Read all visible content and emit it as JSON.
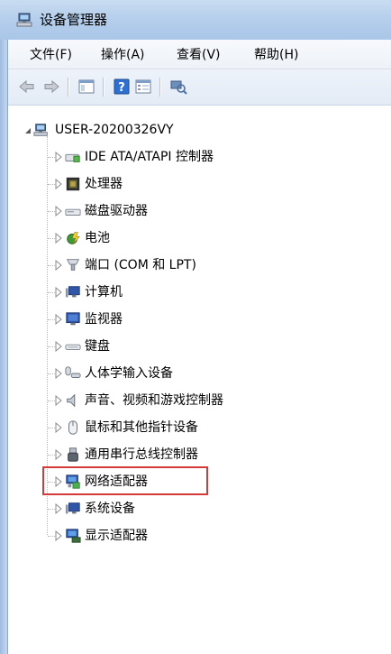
{
  "window": {
    "title": "设备管理器"
  },
  "menu": [
    {
      "label": "文件(F)"
    },
    {
      "label": "操作(A)"
    },
    {
      "label": "查看(V)"
    },
    {
      "label": "帮助(H)"
    }
  ],
  "toolbar": {
    "buttons": [
      "back-icon",
      "forward-icon",
      "show-hide-console-tree-icon",
      "help-icon",
      "properties-icon",
      "scan-hardware-icon"
    ]
  },
  "tree": {
    "root": {
      "label": "USER-20200326VY",
      "expanded": true
    },
    "items": [
      {
        "label": "IDE ATA/ATAPI 控制器",
        "icon": "ide-controller-icon"
      },
      {
        "label": "处理器",
        "icon": "processor-icon"
      },
      {
        "label": "磁盘驱动器",
        "icon": "disk-drive-icon"
      },
      {
        "label": "电池",
        "icon": "battery-icon"
      },
      {
        "label": "端口 (COM 和 LPT)",
        "icon": "port-icon"
      },
      {
        "label": "计算机",
        "icon": "computer-icon"
      },
      {
        "label": "监视器",
        "icon": "monitor-icon"
      },
      {
        "label": "键盘",
        "icon": "keyboard-icon"
      },
      {
        "label": "人体学输入设备",
        "icon": "hid-icon"
      },
      {
        "label": "声音、视频和游戏控制器",
        "icon": "sound-icon"
      },
      {
        "label": "鼠标和其他指针设备",
        "icon": "mouse-icon"
      },
      {
        "label": "通用串行总线控制器",
        "icon": "usb-icon"
      },
      {
        "label": "网络适配器",
        "icon": "network-adapter-icon",
        "highlighted": true
      },
      {
        "label": "系统设备",
        "icon": "system-devices-icon"
      },
      {
        "label": "显示适配器",
        "icon": "display-adapter-icon"
      }
    ]
  },
  "colors": {
    "highlight": "#d53a3a",
    "title_glass": "#b6cfec",
    "menu_bg": "#f2f5fa"
  }
}
